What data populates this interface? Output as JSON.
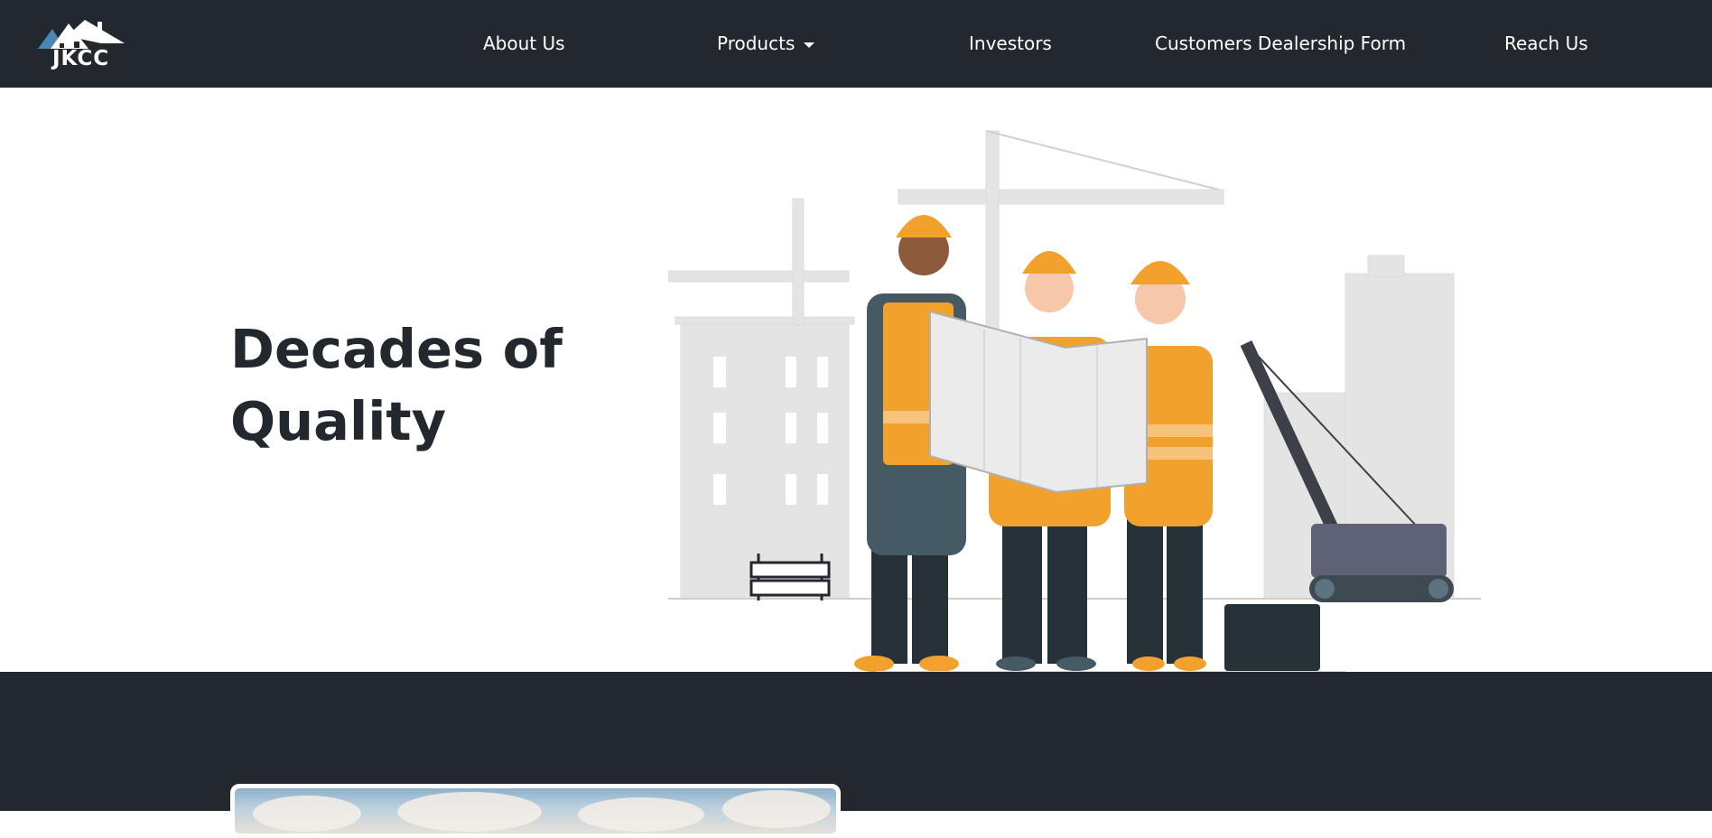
{
  "brand": {
    "logo_text": "JKCC",
    "logo_icon": "house-roof-logo-icon"
  },
  "nav": {
    "items": [
      {
        "label": "About Us"
      },
      {
        "label": "Products",
        "has_dropdown": true
      },
      {
        "label": "Investors"
      },
      {
        "label": "Customers Dealership Form"
      },
      {
        "label": "Reach Us"
      }
    ]
  },
  "hero": {
    "title_line1": "Decades of",
    "title_line2": "Quality",
    "illustration": "construction-workers-with-blueprint-illustration"
  },
  "colors": {
    "nav_bg": "#23272e",
    "accent_orange": "#f2a12c",
    "text_dark": "#23272e"
  }
}
